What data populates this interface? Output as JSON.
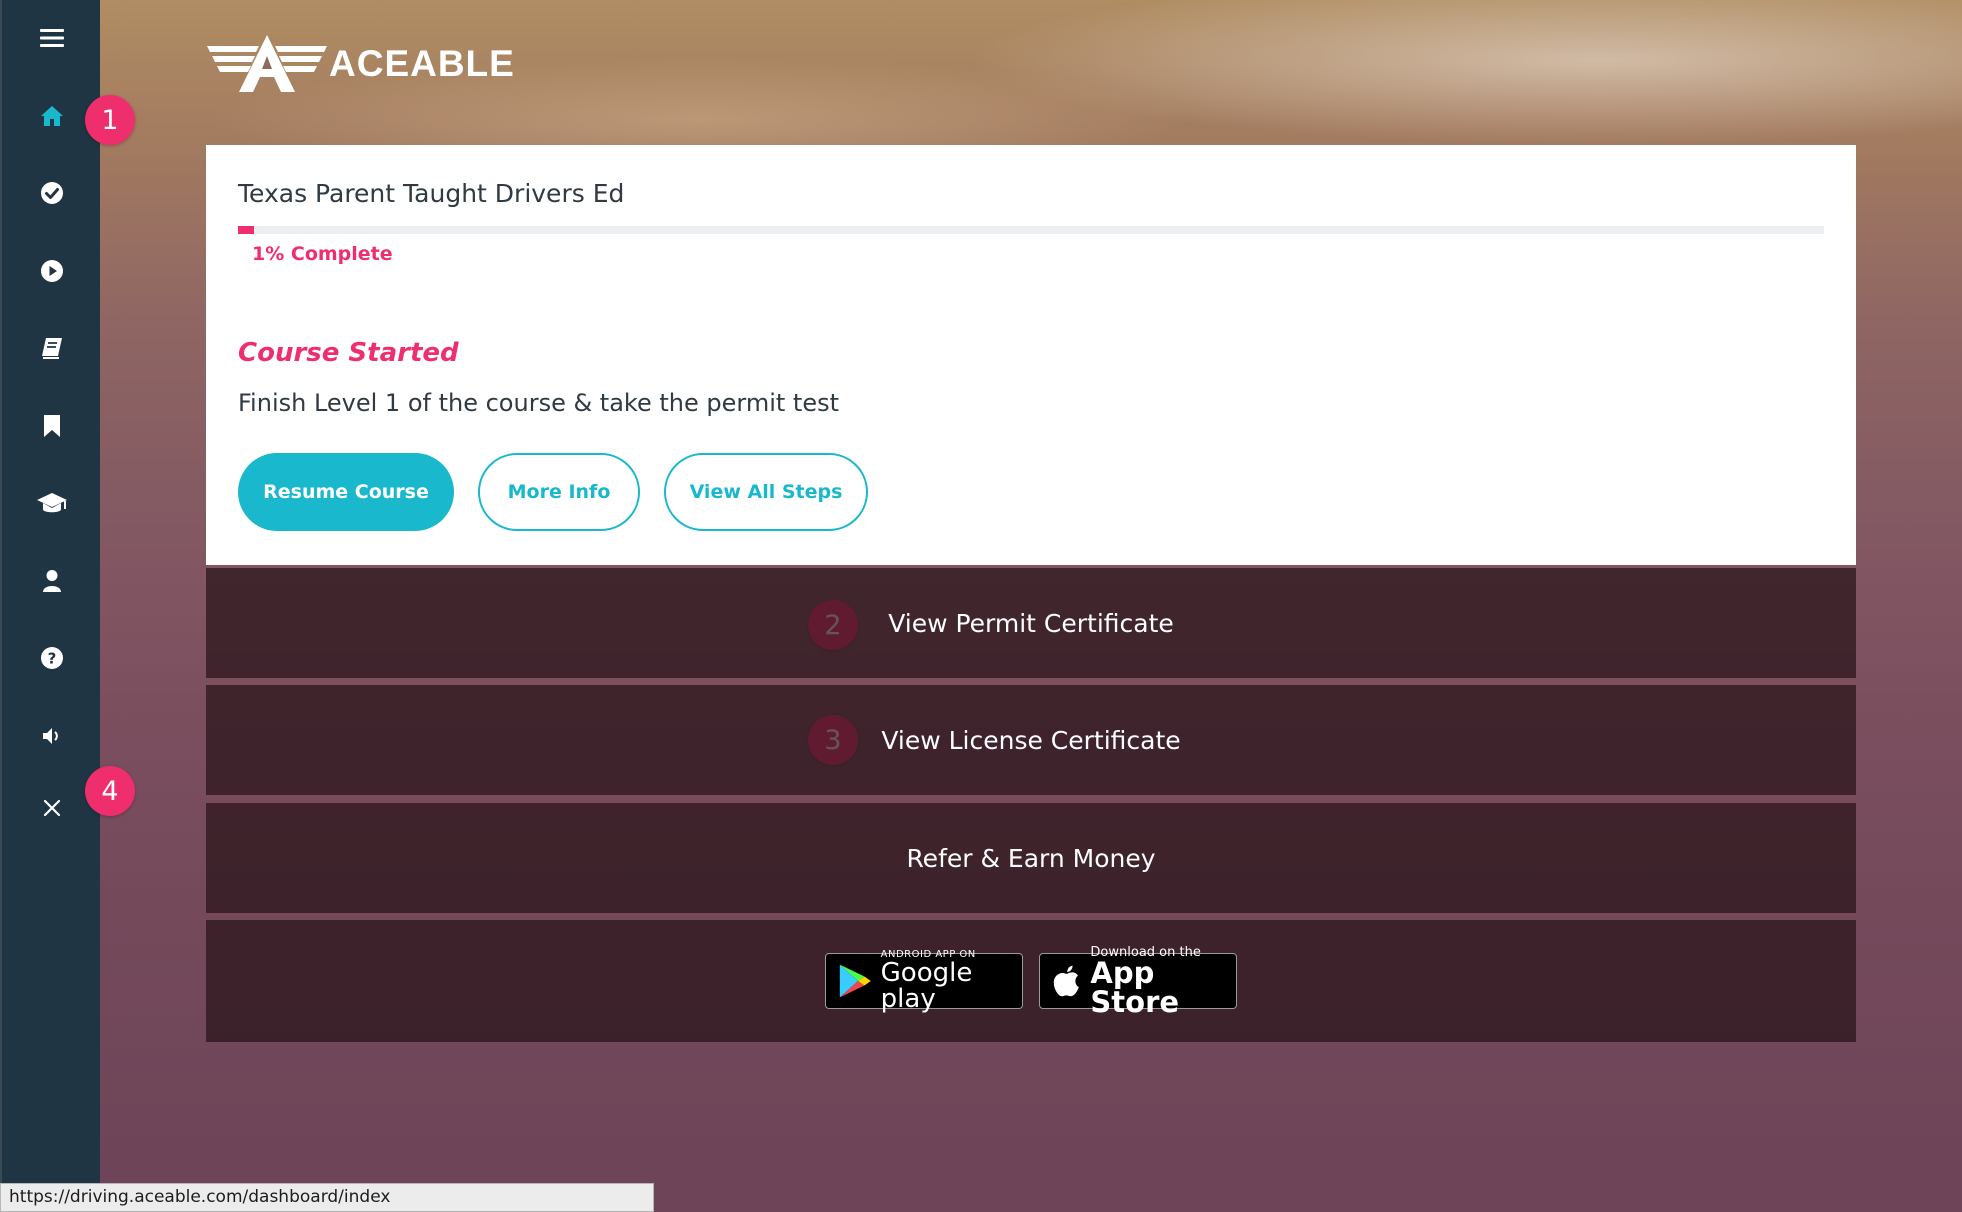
{
  "brand": {
    "name": "ACEABLE"
  },
  "sidebar": {
    "items": [
      {
        "name": "menu-icon",
        "active": false
      },
      {
        "name": "home-icon",
        "active": true
      },
      {
        "name": "check-circle-icon",
        "active": false
      },
      {
        "name": "play-circle-icon",
        "active": false
      },
      {
        "name": "book-icon",
        "active": false
      },
      {
        "name": "bookmark-icon",
        "active": false
      },
      {
        "name": "graduation-cap-icon",
        "active": false
      },
      {
        "name": "user-icon",
        "active": false
      },
      {
        "name": "help-circle-icon",
        "active": false
      },
      {
        "name": "volume-icon",
        "active": false
      },
      {
        "name": "close-icon",
        "active": false
      }
    ],
    "active_color": "#1ab8cc",
    "background_color": "#1f3543"
  },
  "annotations": [
    "1",
    "2",
    "3",
    "4"
  ],
  "course": {
    "title": "Texas Parent Taught Drivers Ed",
    "progress_percent": 1,
    "progress_label": "1% Complete",
    "status_heading": "Course Started",
    "status_text": "Finish Level 1 of the course & take the permit test",
    "buttons": {
      "resume": "Resume Course",
      "more_info": "More Info",
      "view_steps": "View All Steps"
    }
  },
  "links": {
    "permit": "View Permit Certificate",
    "license": "View License Certificate",
    "refer": "Refer & Earn Money"
  },
  "app_badges": {
    "google_small": "ANDROID APP ON",
    "google_big": "Google play",
    "apple_small": "Download on the",
    "apple_big": "App Store"
  },
  "status_bar": {
    "url": "https://driving.aceable.com/dashboard/index"
  },
  "colors": {
    "accent_pink": "#ef2f6d",
    "accent_teal": "#1ab8cc",
    "text_dark": "#2f3a43"
  }
}
